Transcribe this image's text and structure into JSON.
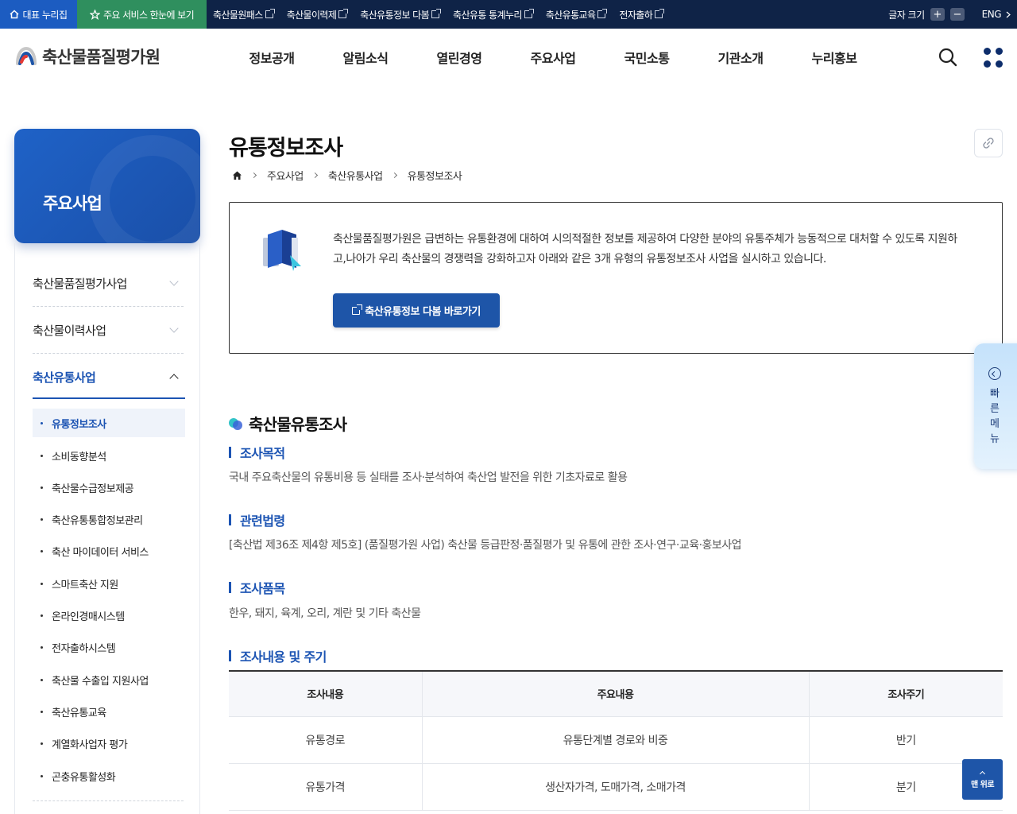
{
  "topbar": {
    "home_label": "대표 누리집",
    "services_label": "주요 서비스 한눈에 보기",
    "links": [
      "축산물원패스",
      "축산물이력제",
      "축산유통정보 다봄",
      "축산유통 통계누리",
      "축산유통교육",
      "전자출하"
    ],
    "font_size_label": "글자 크기",
    "plus": "+",
    "minus": "−",
    "lang": "ENG"
  },
  "header": {
    "logo_text": "축산물품질평가원",
    "nav": [
      "정보공개",
      "알림소식",
      "열린경영",
      "주요사업",
      "국민소통",
      "기관소개",
      "누리홍보"
    ]
  },
  "side": {
    "title": "주요사업",
    "groups": [
      "축산물품질평가사업",
      "축산물이력사업",
      "축산유통사업"
    ],
    "sub_items": [
      "유통정보조사",
      "소비동향분석",
      "축산물수급정보제공",
      "축산유통통합정보관리",
      "축산 마이데이터 서비스",
      "스마트축산 지원",
      "온라인경매시스템",
      "전자출하시스템",
      "축산물 수출입 지원사업",
      "축산유통교육",
      "계열화사업자 평가",
      "곤충유통활성화"
    ]
  },
  "main": {
    "title": "유통정보조사",
    "breadcrumb": [
      "주요사업",
      "축산유통사업",
      "유통정보조사"
    ],
    "intro_text": "축산물품질평가원은 급변하는 유통환경에 대하여 시의적절한 정보를 제공하여 다양한 분야의 유통주체가 능동적으로 대처할 수 있도록 지원하고,나아가 우리 축산물의 경쟁력을 강화하고자 아래와 같은 3개 유형의 유통정보조사 사업을 실시하고 있습니다.",
    "intro_button": "축산유통정보 다봄 바로가기",
    "section_title": "축산물유통조사",
    "purpose_head": "조사목적",
    "purpose_body": "국내 주요축산물의 유통비용 등 실태를 조사·분석하여 축산업 발전을 위한 기초자료로 활용",
    "law_head": "관련법령",
    "law_body": "[축산법 제36조 제4항 제5호] (품질평가원 사업) 축산물 등급판정·품질평가 및 유통에 관한 조사·연구·교육·홍보사업",
    "items_head": "조사품목",
    "items_body": "한우, 돼지, 육계, 오리, 계란 및 기타 축산물",
    "content_head": "조사내용 및 주기",
    "table": {
      "headers": [
        "조사내용",
        "주요내용",
        "조사주기"
      ],
      "rows": [
        [
          "유통경로",
          "유통단계별 경로와 비중",
          "반기"
        ],
        [
          "유통가격",
          "생산자가격, 도매가격, 소매가격",
          "분기"
        ]
      ]
    }
  },
  "quick_menu": "빠른메뉴",
  "top_button": "맨 위로",
  "colors": {
    "topbar": "#0f2347",
    "accent": "#1c54b3",
    "home": "#1c5cc1",
    "services": "#2f8f5e"
  }
}
